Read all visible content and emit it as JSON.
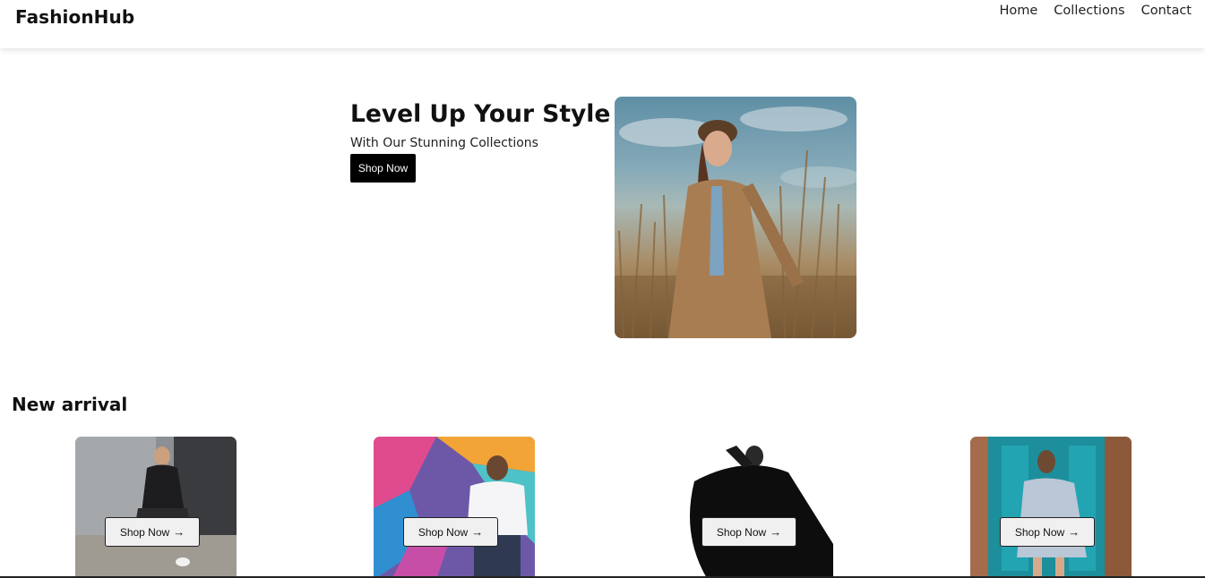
{
  "header": {
    "brand": "FashionHub",
    "nav": [
      "Home",
      "Collections",
      "Contact"
    ]
  },
  "hero": {
    "title": "Level Up Your Style",
    "subtitle": "With Our Stunning Collections",
    "cta_label": "Shop Now"
  },
  "new_arrival": {
    "title": "New arrival",
    "cards": [
      {
        "cta_label": "Shop Now",
        "arrow": "→"
      },
      {
        "cta_label": "Shop Now",
        "arrow": "→"
      },
      {
        "cta_label": "Shop Now",
        "arrow": "→"
      },
      {
        "cta_label": "Shop Now",
        "arrow": "→"
      }
    ]
  },
  "colors": {
    "accent": "#000000",
    "background": "#ffffff",
    "card_button": "#f0f0f0"
  }
}
